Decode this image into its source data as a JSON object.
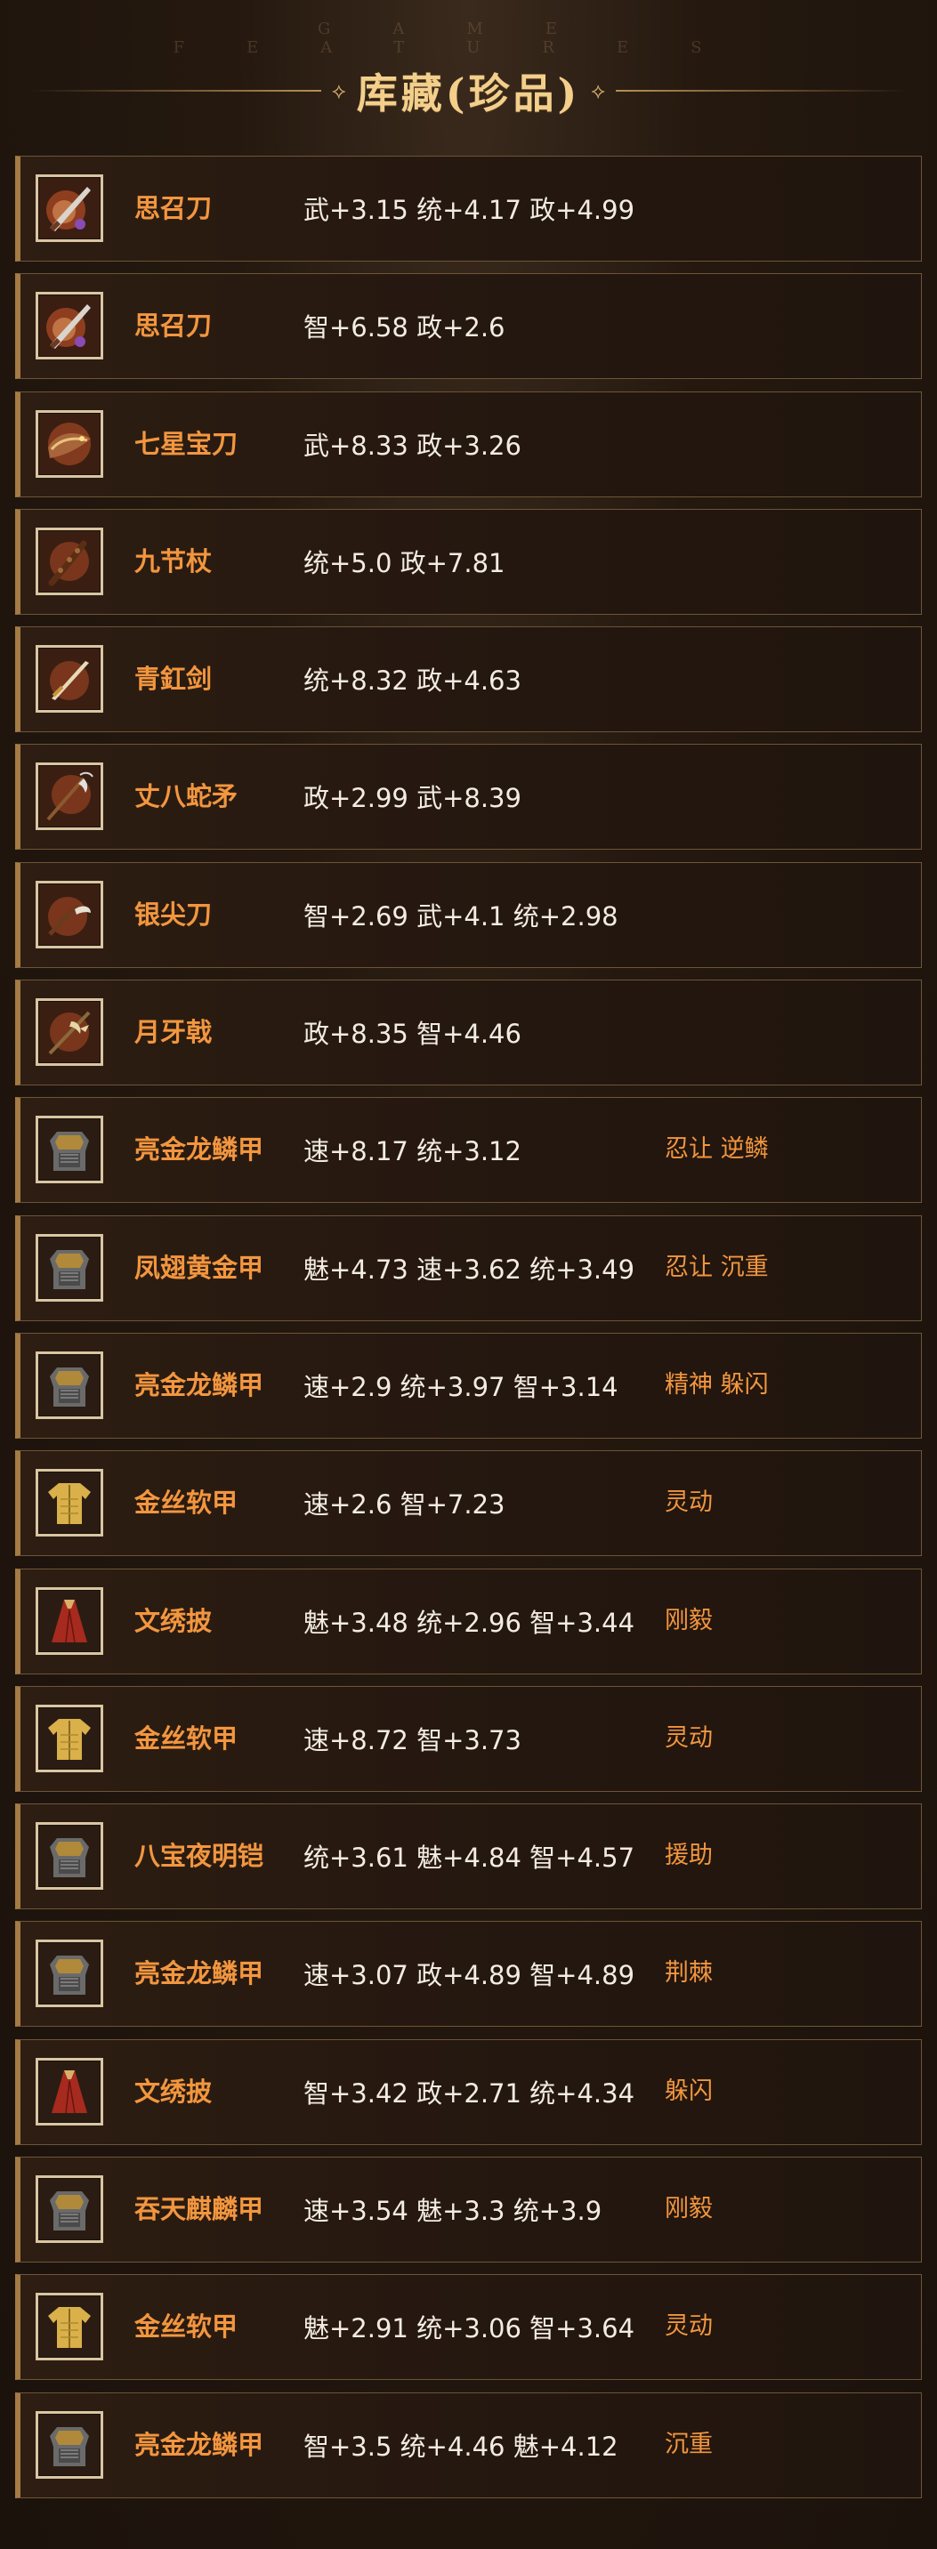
{
  "header": {
    "features": "GAME FEATURES",
    "title": "库藏(珍品)",
    "ornament_left": "⟡",
    "ornament_right": "⟡"
  },
  "items": [
    {
      "name": "思召刀",
      "stats": "武+3.15 统+4.17 政+4.99",
      "skills": "",
      "icon": "blade-icon"
    },
    {
      "name": "思召刀",
      "stats": "智+6.58 政+2.6",
      "skills": "",
      "icon": "blade-icon"
    },
    {
      "name": "七星宝刀",
      "stats": "武+8.33 政+3.26",
      "skills": "",
      "icon": "dragon-blade-icon"
    },
    {
      "name": "九节杖",
      "stats": "统+5.0 政+7.81",
      "skills": "",
      "icon": "staff-icon"
    },
    {
      "name": "青釭剑",
      "stats": "统+8.32 政+4.63",
      "skills": "",
      "icon": "sword-icon"
    },
    {
      "name": "丈八蛇矛",
      "stats": "政+2.99 武+8.39",
      "skills": "",
      "icon": "spear-icon"
    },
    {
      "name": "银尖刀",
      "stats": "智+2.69 武+4.1 统+2.98",
      "skills": "",
      "icon": "glaive-icon"
    },
    {
      "name": "月牙戟",
      "stats": "政+8.35 智+4.46",
      "skills": "",
      "icon": "halberd-icon"
    },
    {
      "name": "亮金龙鳞甲",
      "stats": "速+8.17 统+3.12",
      "skills": "忍让 逆鳞",
      "icon": "armor-icon"
    },
    {
      "name": "凤翅黄金甲",
      "stats": "魅+4.73 速+3.62 统+3.49",
      "skills": "忍让 沉重",
      "icon": "armor-icon"
    },
    {
      "name": "亮金龙鳞甲",
      "stats": "速+2.9 统+3.97 智+3.14",
      "skills": "精神 躲闪",
      "icon": "armor-icon"
    },
    {
      "name": "金丝软甲",
      "stats": "速+2.6 智+7.23",
      "skills": "灵动",
      "icon": "vest-icon"
    },
    {
      "name": "文绣披",
      "stats": "魅+3.48 统+2.96 智+3.44",
      "skills": "刚毅",
      "icon": "cloak-icon"
    },
    {
      "name": "金丝软甲",
      "stats": "速+8.72 智+3.73",
      "skills": "灵动",
      "icon": "vest-icon"
    },
    {
      "name": "八宝夜明铠",
      "stats": "统+3.61 魅+4.84 智+4.57",
      "skills": "援助",
      "icon": "armor-icon"
    },
    {
      "name": "亮金龙鳞甲",
      "stats": "速+3.07 政+4.89 智+4.89",
      "skills": "荆棘",
      "icon": "armor-icon"
    },
    {
      "name": "文绣披",
      "stats": "智+3.42 政+2.71 统+4.34",
      "skills": "躲闪",
      "icon": "cloak-icon"
    },
    {
      "name": "吞天麒麟甲",
      "stats": "速+3.54 魅+3.3 统+3.9",
      "skills": "刚毅",
      "icon": "armor-icon"
    },
    {
      "name": "金丝软甲",
      "stats": "魅+2.91 统+3.06 智+3.64",
      "skills": "灵动",
      "icon": "vest-icon"
    },
    {
      "name": "亮金龙鳞甲",
      "stats": "智+3.5 统+4.46 魅+4.12",
      "skills": "沉重",
      "icon": "armor-icon"
    }
  ]
}
